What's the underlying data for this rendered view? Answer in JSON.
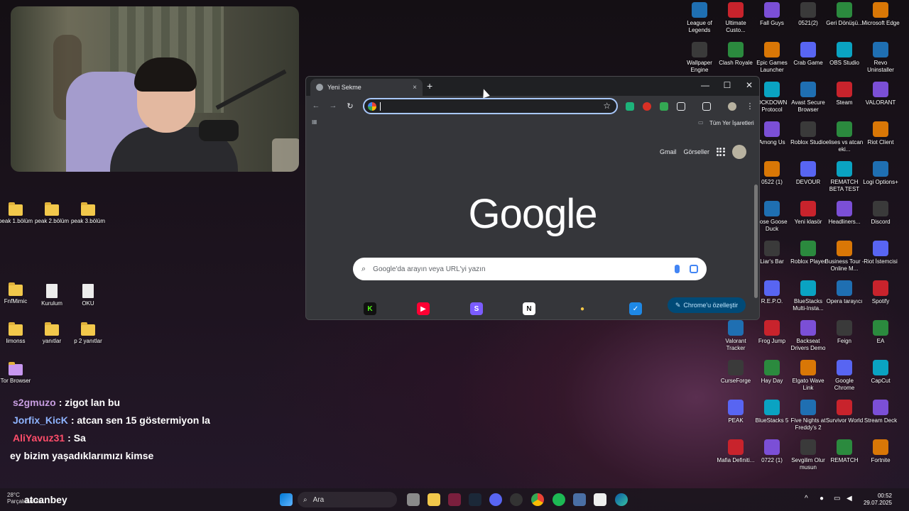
{
  "browser": {
    "tab_title": "Yeni Sekme",
    "tab_close": "×",
    "new_tab": "+",
    "minimize": "—",
    "maximize": "☐",
    "close": "✕",
    "back": "←",
    "forward": "→",
    "reload": "↻",
    "address_value": "",
    "star": "☆",
    "all_bookmarks": "Tüm Yer İşaretleri",
    "gmail": "Gmail",
    "images": "Görseller",
    "logo": "Google",
    "search_placeholder": "Google'da arayın veya URL'yi yazın",
    "customize": "Chrome'u özelleştir",
    "shortcuts": [
      {
        "icon": "K",
        "color": "#53fc18",
        "bg": "#111"
      },
      {
        "icon": "▶",
        "color": "#fff",
        "bg": "#ff0033"
      },
      {
        "icon": "S",
        "color": "#fff",
        "bg": "#7b5cff"
      },
      {
        "icon": "N",
        "color": "#111",
        "bg": "#fff"
      },
      {
        "icon": "●",
        "color": "#f7c948",
        "bg": "#35363a"
      },
      {
        "icon": "✓",
        "color": "#fff",
        "bg": "#1e88e5"
      }
    ]
  },
  "left_icons": {
    "row1": [
      "peak 1.bölüm",
      "peak 2.bölüm",
      "peak 3.bölüm"
    ],
    "row2": [
      "FnfMimic",
      "Kurulum",
      "OKU"
    ],
    "row3": [
      "limonss",
      "yanıtlar",
      "p 2 yanıtlar"
    ],
    "row4": [
      "Tor Browser"
    ]
  },
  "right_icons": [
    [
      "League of Legends",
      "Ultimate Custo...",
      "Fall Guys",
      "0521(2)",
      "Geri Dönüşü...",
      "Microsoft Edge"
    ],
    [
      "Wallpaper Engine",
      "Clash Royale",
      "Epic Games Launcher",
      "Crab Game",
      "OBS Studio",
      "Revo Uninstaller"
    ],
    [
      "",
      "OCKDOWN Protocol",
      "Avast Secure Browser",
      "Steam",
      "VALORANT"
    ],
    [
      "",
      "Among Us",
      "Roblox Studio",
      "elises vs atcan eki...",
      "Riot Client"
    ],
    [
      "",
      "0522 (1)",
      "DEVOUR",
      "REMATCH BETA TEST",
      "Logi Options+"
    ],
    [
      "",
      "oose Goose Duck",
      "Yeni klasör",
      "Headliners...",
      "Discord"
    ],
    [
      "",
      "Liar's Bar",
      "Roblox Player",
      "Business Tour - Online M...",
      "Riot İstemcisi"
    ],
    [
      "",
      "R.E.P.O.",
      "BlueStacks Multi-Insta...",
      "Opera tarayıcı",
      "Spotify"
    ],
    [
      "Valorant Tracker",
      "Frog Jump",
      "Backseat Drivers Demo",
      "Feign",
      "EA"
    ],
    [
      "CurseForge",
      "Hay Day",
      "Elgato Wave Link",
      "Google Chrome",
      "CapCut"
    ],
    [
      "PEAK",
      "BlueStacks 5",
      "Five Nights at Freddy's 2",
      "Survivor World",
      "Stream Deck"
    ],
    [
      "Mafia Definiti...",
      "0722 (1)",
      "Sevgilim Olur musun",
      "REMATCH",
      "Fortnite"
    ]
  ],
  "chat": [
    {
      "user": "s2gmuzo",
      "color": "#c79de0",
      "message": ": zigot lan bu"
    },
    {
      "user": "Jorfix_KicK",
      "color": "#8fb4ff",
      "message": ": atcan sen 15 göstermiyon la"
    },
    {
      "user": "AliYavuz31",
      "color": "#ff4d6a",
      "message": ": Sa"
    },
    {
      "user": "",
      "color": "#ffffff",
      "message": "ey bizim yaşadıklarımızı kimse"
    }
  ],
  "taskbar": {
    "weather_temp": "28°C",
    "weather_desc": "Parçalı bulutlu",
    "streamer_name": "atcanbey",
    "search_label": "Ara",
    "time": "00:52",
    "date": "29.07.2025"
  }
}
